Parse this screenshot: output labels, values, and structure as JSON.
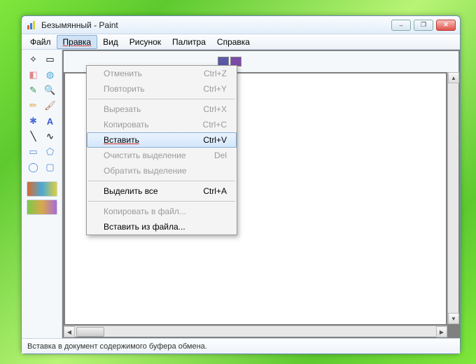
{
  "window": {
    "title": "Безымянный - Paint"
  },
  "menubar": {
    "items": [
      {
        "label": "Файл"
      },
      {
        "label": "Правка",
        "active": true
      },
      {
        "label": "Вид"
      },
      {
        "label": "Рисунок"
      },
      {
        "label": "Палитра"
      },
      {
        "label": "Справка"
      }
    ]
  },
  "dropdown": {
    "items": [
      {
        "label": "Отменить",
        "shortcut": "Ctrl+Z",
        "state": "disabled"
      },
      {
        "label": "Повторить",
        "shortcut": "Ctrl+Y",
        "state": "disabled"
      },
      {
        "sep": true
      },
      {
        "label": "Вырезать",
        "shortcut": "Ctrl+X",
        "state": "disabled"
      },
      {
        "label": "Копировать",
        "shortcut": "Ctrl+C",
        "state": "disabled"
      },
      {
        "label": "Вставить",
        "shortcut": "Ctrl+V",
        "state": "hover"
      },
      {
        "label": "Очистить выделение",
        "shortcut": "Del",
        "state": "disabled"
      },
      {
        "label": "Обратить выделение",
        "shortcut": "",
        "state": "disabled"
      },
      {
        "sep": true
      },
      {
        "label": "Выделить все",
        "shortcut": "Ctrl+A",
        "state": "enabled"
      },
      {
        "sep": true
      },
      {
        "label": "Копировать в файл...",
        "shortcut": "",
        "state": "disabled"
      },
      {
        "label": "Вставить из файла...",
        "shortcut": "",
        "state": "enabled"
      }
    ]
  },
  "palette": {
    "swatches": [
      "#5a5aa8",
      "#7c4aa8"
    ]
  },
  "tools": {
    "rows": [
      [
        "freeform-select",
        "rect-select"
      ],
      [
        "eraser",
        "fill"
      ],
      [
        "picker",
        "magnifier"
      ],
      [
        "pencil",
        "brush"
      ],
      [
        "airbrush",
        "text"
      ],
      [
        "line",
        "curve"
      ],
      [
        "rectangle",
        "polygon"
      ],
      [
        "ellipse",
        "rounded-rect"
      ]
    ]
  },
  "statusbar": {
    "text": "Вставка в документ содержимого буфера обмена."
  },
  "winbuttons": {
    "minimize": "–",
    "maximize": "❐",
    "close": "✕"
  }
}
